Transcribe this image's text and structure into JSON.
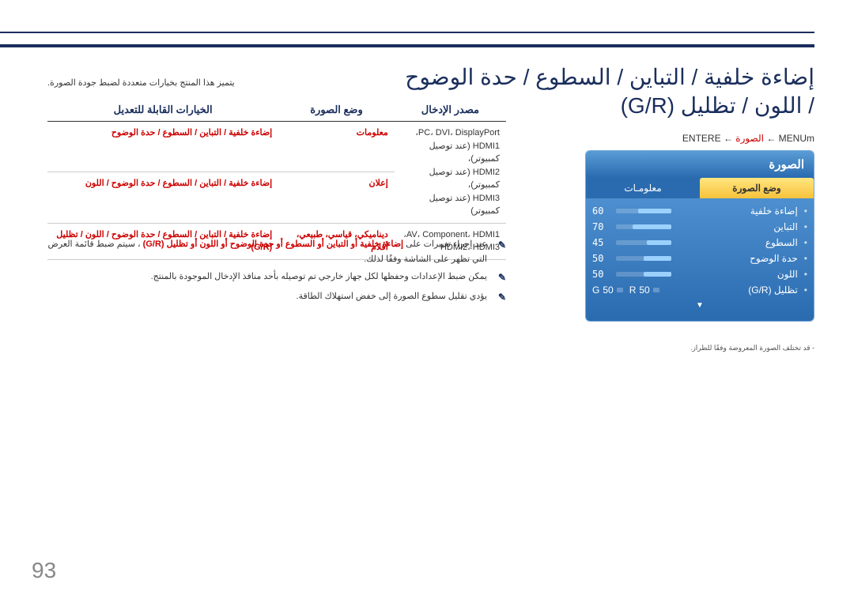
{
  "title_line1": "إضاءة خلفية / التباين / السطوع / حدة الوضوح",
  "title_line2": "/ اللون / تظليل (G/R)",
  "breadcrumb": {
    "menu": "MENUm",
    "arrow": "←",
    "picture": "الصورة",
    "enter": "ENTERE"
  },
  "osd": {
    "header": "الصورة",
    "tab_active": "وضع الصورة",
    "tab_inactive": "معلومـات",
    "rows": [
      {
        "label": "إضاءة خلفية",
        "value": "60",
        "fill": 60
      },
      {
        "label": "التباين",
        "value": "70",
        "fill": 70
      },
      {
        "label": "السطوع",
        "value": "45",
        "fill": 45
      },
      {
        "label": "حدة الوضوح",
        "value": "50",
        "fill": 50
      },
      {
        "label": "اللون",
        "value": "50",
        "fill": 50
      }
    ],
    "tint_label": "تظليل (G/R)",
    "tint_g_label": "G",
    "tint_g_value": "50",
    "tint_r_label": "R",
    "tint_r_value": "50",
    "arrow_down": "▼"
  },
  "osd_note": "- قد تختلف الصورة المعروضة وفقًا للطراز.",
  "intro": "يتميز هذا المنتج بخيارات متعددة لضبط جودة الصورة.",
  "table": {
    "headers": {
      "input": "مصدر الإدخال",
      "mode": "وضع الصورة",
      "options": "الخيارات القابلة للتعديل"
    },
    "rows": [
      {
        "input_lines": [
          "PC، DVI، DisplayPort،",
          "HDMI1 (عند توصيل كمبيوتر)،",
          "HDMI2 (عند توصيل كمبيوتر)،",
          "HDMI3 (عند توصيل كمبيوتر)"
        ],
        "mode": "معلومات",
        "opts": "إضاءة خلفية / التباين / السطوع / حدة الوضوح"
      },
      {
        "input_lines": [
          ""
        ],
        "mode": "إعلان",
        "opts": "إضاءة خلفية / التباين / السطوع / حدة الوضوح / اللون"
      },
      {
        "input_lines": [
          "AV، Component، HDMI1،",
          "HDMI2، HDMI3"
        ],
        "mode": "ديناميكي، قياسي، طبيعي، أفلام",
        "opts": "إضاءة خلفية / التباين / السطوع / حدة الوضوح / اللون / تظليل (G/R)"
      }
    ]
  },
  "hints": [
    {
      "icon": "✎",
      "pre": "عند إجراء تغييرات على ",
      "hl": "إضاءة خلفية أو التباين أو السطوع أو حدة الوضوح أو اللون أو تظليل (G/R)",
      "post": "، سيتم ضبط قائمة العرض التي تظهر على الشاشة وفقًا لذلك."
    },
    {
      "icon": "✎",
      "pre": "يمكن ضبط الإعدادات وحفظها لكل جهاز خارجي تم توصيله بأحد منافذ الإدخال الموجودة بالمنتج.",
      "hl": "",
      "post": ""
    },
    {
      "icon": "✎",
      "pre": "يؤدي تقليل سطوع الصورة إلى خفض استهلاك الطاقة.",
      "hl": "",
      "post": ""
    }
  ],
  "page_number": "93"
}
